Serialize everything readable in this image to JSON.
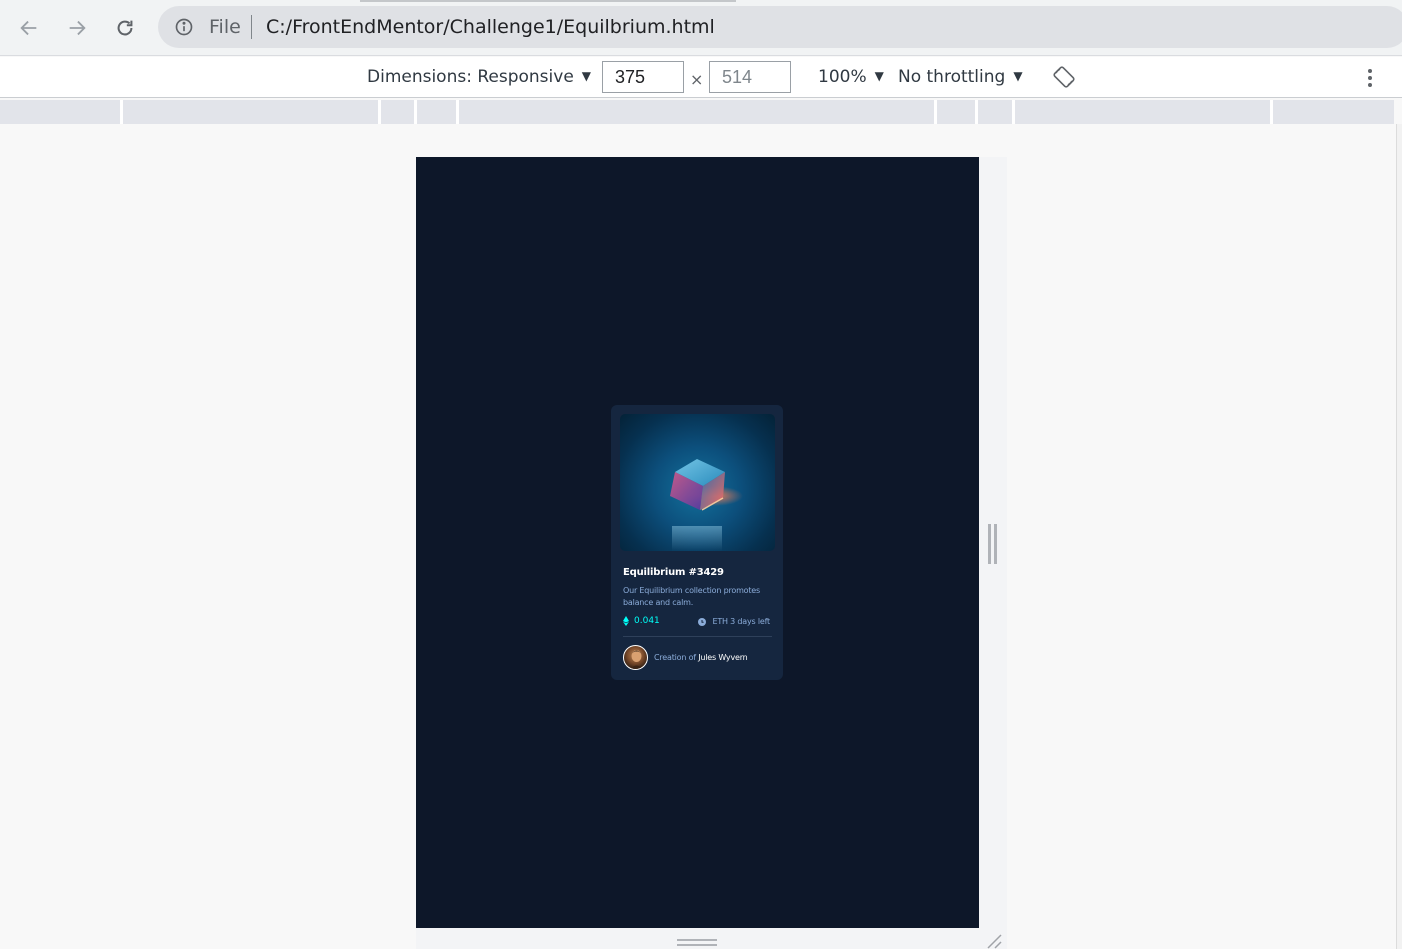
{
  "browser": {
    "address_bar": {
      "scheme_label": "File",
      "url": "C:/FrontEndMentor/Challenge1/Equilbrium.html"
    }
  },
  "devtools": {
    "dimensions_label": "Dimensions: Responsive",
    "width_value": "375",
    "height_value": "514",
    "times_symbol": "×",
    "zoom_label": "100%",
    "throttling_label": "No throttling",
    "caret": "▼"
  },
  "card": {
    "title": "Equilibrium #3429",
    "description": "Our Equilibrium collection promotes balance and calm.",
    "price": "0.041",
    "time_left": "ETH 3 days left",
    "creator_prefix": "Creation of ",
    "creator_name": "Jules Wyvern"
  },
  "colors": {
    "page_bg": "#0d1729",
    "card_bg": "#15263f",
    "accent_cyan": "#00fff8",
    "soft_blue": "#8bacd9"
  }
}
